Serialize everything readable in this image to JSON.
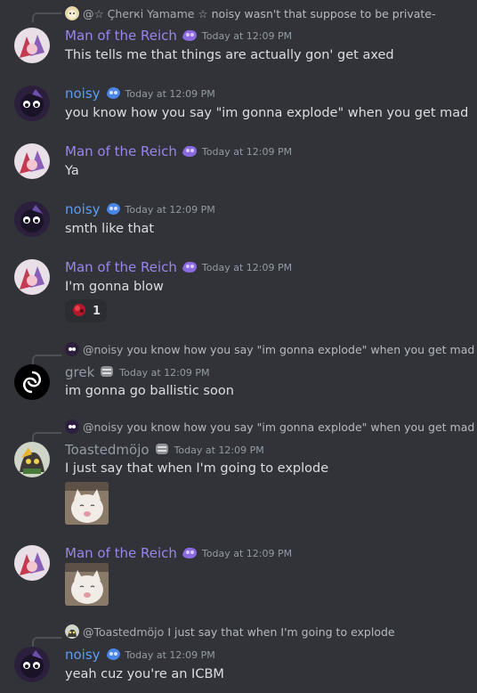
{
  "colors": {
    "background": "#313338",
    "man_of_the_reich": "#9b84ec",
    "noisy": "#5e9cf0",
    "grek": "#949ba4",
    "toasted": "#949ba4"
  },
  "messages": [
    {
      "reply": {
        "at": "@☆ Çherкi Yamame ☆",
        "text": "noisy wasn't that suppose to be private-"
      },
      "author": "Man of the Reich",
      "role_icon": "purple-role-icon",
      "timestamp": "Today at 12:09 PM",
      "text": "This tells me that things are actually gon' get axed"
    },
    {
      "author": "noisy",
      "role_icon": "blue-role-icon",
      "timestamp": "Today at 12:09 PM",
      "text": "you know how you say \"im gonna explode\" when you get mad"
    },
    {
      "author": "Man of the Reich",
      "role_icon": "purple-role-icon",
      "timestamp": "Today at 12:09 PM",
      "text": "Ya"
    },
    {
      "author": "noisy",
      "role_icon": "blue-role-icon",
      "timestamp": "Today at 12:09 PM",
      "text": "smth like that"
    },
    {
      "author": "Man of the Reich",
      "role_icon": "purple-role-icon",
      "timestamp": "Today at 12:09 PM",
      "text": "I'm gonna blow",
      "reaction": {
        "emoji": "explosion-emoji",
        "count": "1"
      }
    },
    {
      "reply": {
        "at": "@noisy",
        "text": "you know how you say \"im gonna explode\" when you get mad"
      },
      "author": "grek",
      "role_icon": "gray-role-icon",
      "timestamp": "Today at 12:09 PM",
      "text": "im gonna go ballistic soon"
    },
    {
      "reply": {
        "at": "@noisy",
        "text": "you know how you say \"im gonna explode\" when you get mad"
      },
      "author": "Toastedmöjo",
      "role_icon": "gray-role-icon",
      "timestamp": "Today at 12:09 PM",
      "text": "I just say that when I'm going to explode",
      "attachment": "cat-image"
    },
    {
      "author": "Man of the Reich",
      "role_icon": "purple-role-icon",
      "timestamp": "Today at 12:09 PM",
      "attachment": "cat-image"
    },
    {
      "reply": {
        "at": "@Toastedmöjo",
        "text": "I just say that when I'm going to explode"
      },
      "author": "noisy",
      "role_icon": "blue-role-icon",
      "timestamp": "Today at 12:09 PM",
      "text": "yeah cuz you're an ICBM"
    }
  ]
}
